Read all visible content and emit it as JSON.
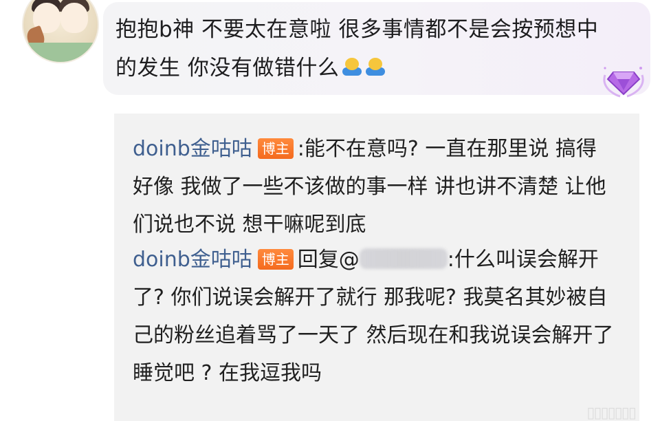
{
  "comment": {
    "text": "抱抱b神 不要太在意啦 很多事情都不是会按预想中的发生 你没有做错什么",
    "emojis": [
      "hugging-emoji",
      "hugging-emoji"
    ],
    "badge_icon": "purple-gem-badge-icon"
  },
  "replies": [
    {
      "username": "doinb金咕咕",
      "tag": "博主",
      "text": ":能不在意吗? 一直在那里说 搞得好像 我做了一些不该做的事一样 讲也讲不清楚 让他们说也不说 想干嘛呢到底"
    },
    {
      "username": "doinb金咕咕",
      "tag": "博主",
      "reply_prefix": "回复@",
      "text": ":什么叫误会解开了? 你们说误会解开了就行 那我呢? 我莫名其妙被自己的粉丝追着骂了一天了 然后现在和我说误会解开了睡觉吧 ? 在我逗我吗"
    }
  ],
  "colors": {
    "username": "#3f5f8f",
    "host_tag": "#f46a1f",
    "panel_bg": "#f2f2f2"
  }
}
